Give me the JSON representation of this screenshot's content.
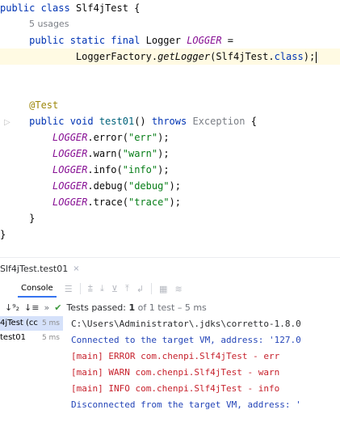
{
  "editor": {
    "usages": "5 usages",
    "line_class": [
      "public ",
      "class ",
      "Slf4jTest {"
    ],
    "field_decl": {
      "mods": "public static final ",
      "type": "Logger ",
      "name": "LOGGER",
      "eq": " ="
    },
    "factory": {
      "prefix": "LoggerFactory.",
      "method": "getLogger",
      "arg": "(Slf4jTest.",
      "cls": "class",
      "end": ");"
    },
    "annotation": "@Test",
    "method_decl": {
      "mods": "public void ",
      "name": "test01",
      "paren": "() ",
      "throws": "throws ",
      "exc": "Exception",
      "brace": " {"
    },
    "calls": [
      {
        "obj": "LOGGER",
        "call": ".error(",
        "arg": "\"err\"",
        "end": ");"
      },
      {
        "obj": "LOGGER",
        "call": ".warn(",
        "arg": "\"warn\"",
        "end": ");"
      },
      {
        "obj": "LOGGER",
        "call": ".info(",
        "arg": "\"info\"",
        "end": ");"
      },
      {
        "obj": "LOGGER",
        "call": ".debug(",
        "arg": "\"debug\"",
        "end": ");"
      },
      {
        "obj": "LOGGER",
        "call": ".trace(",
        "arg": "\"trace\"",
        "end": ");"
      }
    ],
    "close_inner": "}",
    "close_outer": "}"
  },
  "run_panel": {
    "tab_label": "Slf4jTest.test01",
    "close_glyph": "×",
    "console_label": "Console",
    "status_check": "✔",
    "status_prefix": "Tests passed: ",
    "status_count": "1",
    "status_suffix": " of 1 test – 5 ms",
    "sort_icon_1": "↓⁹₂",
    "sort_icon_2": "↓≡",
    "more": "»",
    "tree": [
      {
        "label": "4jTest (cc",
        "time": "5 ms"
      },
      {
        "label": "test01",
        "time": "5 ms"
      }
    ],
    "output": [
      {
        "text": "C:\\Users\\Administrator\\.jdks\\corretto-1.8.0",
        "kind": "gray"
      },
      {
        "text": "Connected to the target VM, address: '127.0",
        "kind": "blue"
      },
      {
        "text": "[main] ERROR com.chenpi.Slf4jTest - err",
        "kind": "red"
      },
      {
        "text": "[main] WARN com.chenpi.Slf4jTest - warn",
        "kind": "red"
      },
      {
        "text": "[main] INFO com.chenpi.Slf4jTest - info",
        "kind": "red"
      },
      {
        "text": "Disconnected from the target VM, address: '",
        "kind": "blue"
      }
    ]
  }
}
